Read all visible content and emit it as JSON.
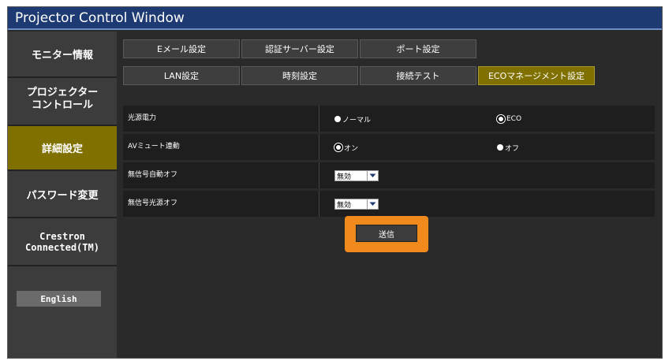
{
  "window": {
    "title": "Projector Control Window"
  },
  "sidebar": {
    "items": [
      {
        "label": "モニター情報"
      },
      {
        "label": "プロジェクター\nコントロール"
      },
      {
        "label": "詳細設定"
      },
      {
        "label": "パスワード変更"
      },
      {
        "label": "Crestron\nConnected(TM)"
      }
    ],
    "english_label": "English"
  },
  "tabs": [
    {
      "label": "Eメール設定"
    },
    {
      "label": "認証サーバー設定"
    },
    {
      "label": "ポート設定"
    },
    {
      "label": "LAN設定"
    },
    {
      "label": "時刻設定"
    },
    {
      "label": "接続テスト"
    },
    {
      "label": "ECOマネージメント設定"
    }
  ],
  "settings": {
    "light_power": {
      "label": "光源電力",
      "option1": "ノーマル",
      "option2": "ECO",
      "selected": "ECO"
    },
    "av_mute": {
      "label": "AVミュート連動",
      "option1": "オン",
      "option2": "オフ",
      "selected": "オン"
    },
    "no_signal_auto_off": {
      "label": "無信号自動オフ",
      "value": "無効"
    },
    "no_signal_light_off": {
      "label": "無信号光源オフ",
      "value": "無効"
    }
  },
  "submit_label": "送信",
  "colors": {
    "title_bar": "#1e3a72",
    "active": "#807000",
    "highlight": "#f08a1c"
  }
}
